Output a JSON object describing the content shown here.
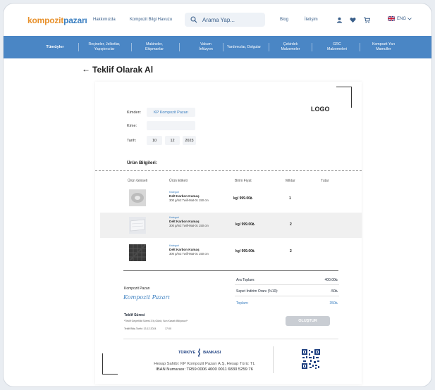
{
  "header": {
    "logo_part1": "kompozit",
    "logo_part2": "pazarı",
    "links": [
      "Hakkımızda",
      "Kompozit Bilgi Havuzu"
    ],
    "search_placeholder": "Arama Yap...",
    "right_links": [
      "Blog",
      "İletişim"
    ],
    "language": "ENG"
  },
  "nav": {
    "items": [
      {
        "label": "Tümüyler"
      },
      {
        "label": "Reçineler, Jelkotlar, Yapıştırıcılar"
      },
      {
        "label": "Makineler, Ekipmanlar"
      },
      {
        "label": "Vakum İnfüzyon"
      },
      {
        "label": "Yardımcılar, Dolgular"
      },
      {
        "label": "Çekirdek Malzemeler"
      },
      {
        "label": "GRC Malzemeleri"
      },
      {
        "label": "Kompozit Yarı Mamuller"
      }
    ]
  },
  "page": {
    "back_arrow": "←",
    "title": "Teklif Olarak Al"
  },
  "document": {
    "logo": "LOGO",
    "fields": {
      "kimden_label": "Kimden:",
      "kimden_value": "KP Kompozit Pazarı",
      "kime_label": "Kime:",
      "kime_value": "",
      "tarih_label": "Tarih:",
      "day": "10",
      "month": "12",
      "year": "2023"
    },
    "section_title": "Ürün Bilgileri:",
    "columns": [
      "Ürün Görseli",
      "Ürün Etiketi",
      "Birim Fiyat",
      "Miktar",
      "Tutar"
    ],
    "products": [
      {
        "category": "Kategori",
        "name": "Delt Karbon Kumaş",
        "desc": "300 g/m2 Twill-Mat-0c 150 cm",
        "price": "kg/ 999.00₺",
        "qty": "1",
        "thumb_color": "#cfcfcf"
      },
      {
        "category": "Kategori",
        "name": "Delt Karbon Kumaş",
        "desc": "300 g/m2 Twill-Mat-0c 150 cm",
        "price": "kg/ 999.00₺",
        "qty": "2",
        "thumb_color": "#e2e4e8"
      },
      {
        "category": "Kategori",
        "name": "Delt Karbon Kumaş",
        "desc": "300 g/m2 Twill-Mat-0c 150 cm",
        "price": "kg/ 999.00₺",
        "qty": "2",
        "thumb_color": "#3a3a3a"
      }
    ],
    "company": "Kompozit Pazarı",
    "signature": "Kompozit Pazarı",
    "totals": [
      {
        "label": "Ara Toplam:",
        "value": "400.00₺"
      },
      {
        "label": "Sepet İndirim Oranı (%10):",
        "value": "-50₺"
      },
      {
        "label": "Toplam:",
        "value": "350₺"
      }
    ],
    "teklif_title": "Teklif Süresi",
    "teklif_note": "*Teklif Geçerlilik Süresi 3 İş Günü; Son Kararlı Biliyoruz!*",
    "teklif_date": "Teklif Bitiş Tarihi: 13.12.2024",
    "teklif_time": "17:00",
    "create_button": "OLUŞTUR",
    "bank": {
      "name_left": "TÜRKİYE",
      "name_right": "BANKASI",
      "holder": "Hesap Sahibi: KP Kompozit Pazarı A.Ş, Hesap Türü: TL",
      "iban": "IBAN Numarası: TR59 0006 4000 0011 6830 5259 76"
    }
  }
}
